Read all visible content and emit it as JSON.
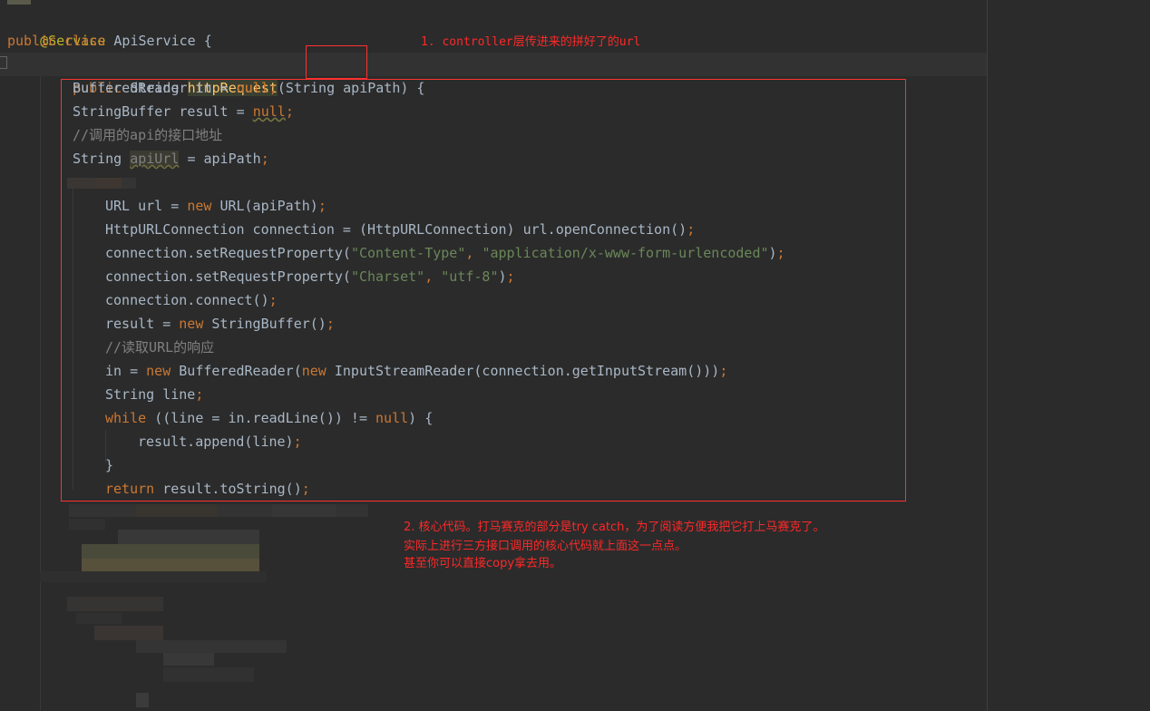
{
  "editor": {
    "lines": {
      "service_annotation": "@Service",
      "class_kw": "public class",
      "class_name": "ApiService",
      "class_brace": "{",
      "method_kw": "public",
      "method_type": "String",
      "method_name": "httpRequest",
      "method_paren_open": "(String",
      "method_param": "apiPath",
      "method_paren_close": ") {",
      "l1_type": "BufferedReader in =",
      "l1_val": "null",
      "l2_type": "StringBuffer result =",
      "l2_val": "null",
      "l3_comment": "//调用的api的接口地址",
      "l4_type": "String",
      "l4_var": "apiUrl",
      "l4_rest": "= apiPath",
      "l5_type": "URL url =",
      "l5_new": "new",
      "l5_rest": "URL(apiPath)",
      "l6_text": "HttpURLConnection connection = (HttpURLConnection) url.openConnection()",
      "l7_call": "connection.setRequestProperty(",
      "l7_str1": "\"Content-Type\"",
      "l7_str2": "\"application/x-www-form-urlencoded\"",
      "l8_call": "connection.setRequestProperty(",
      "l8_str1": "\"Charset\"",
      "l8_str2": "\"utf-8\"",
      "l9_text": "connection.connect()",
      "l10_lhs": "result =",
      "l10_new": "new",
      "l10_rest": "StringBuffer()",
      "l11_comment": "//读取URL的响应",
      "l12_lhs": "in =",
      "l12_new1": "new",
      "l12_mid": "BufferedReader(",
      "l12_new2": "new",
      "l12_rest": "InputStreamReader(connection.getInputStream()))",
      "l13_text": "String line",
      "l14_while": "while",
      "l14_cond": "((line = in.readLine()) !=",
      "l14_null": "null",
      "l14_end": ") {",
      "l15_text": "result.append(line)",
      "l16_text": "}",
      "l17_return": "return",
      "l17_rest": "result.toString()"
    }
  },
  "annotations": {
    "note1": "1. controller层传进来的拼好了的url",
    "note2_line1": "2. 核心代码。打马赛克的部分是try catch，为了阅读方便我把它打上马赛克了。",
    "note2_line2": "实际上进行三方接口调用的核心代码就上面这一点点。",
    "note2_line3": "甚至你可以直接copy拿去用。"
  },
  "colors": {
    "background": "#2b2b2b",
    "keyword": "#cc7832",
    "string": "#6a8759",
    "comment": "#808080",
    "method": "#ffc66d",
    "annotation": "#bbb529",
    "red_markup": "#ff3030"
  }
}
